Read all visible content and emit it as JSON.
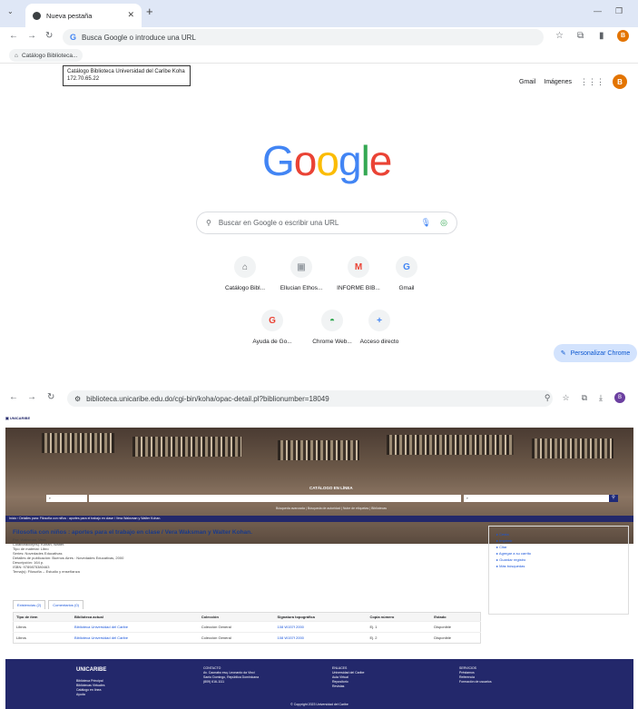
{
  "top_window": {
    "tab_title": "Nueva pestaña",
    "omnibox_placeholder": "Busca Google o introduce una URL",
    "bookmark": "Catálogo Biblioteca...",
    "tooltip_line1": "Catálogo Biblioteca Universidad del Caribe Koha",
    "tooltip_line2": "172.70.65.22",
    "links": {
      "gmail": "Gmail",
      "images": "Imágenes"
    },
    "avatar_letter": "B",
    "search_placeholder": "Buscar en Google o escribir una URL",
    "shortcuts": [
      {
        "label": "Catálogo Bibl...",
        "glyph": "⌂"
      },
      {
        "label": "Ellucian Ethos...",
        "glyph": "▣"
      },
      {
        "label": "INFORME BIB...",
        "glyph": "M"
      },
      {
        "label": "Gmail",
        "glyph": "G"
      },
      {
        "label": "Ayuda de Go...",
        "glyph": "G"
      },
      {
        "label": "Chrome Web...",
        "glyph": "◓"
      },
      {
        "label": "Acceso directo",
        "glyph": "+"
      }
    ],
    "customize_label": "Personalizar Chrome",
    "colors": {
      "blue": "#4285f4",
      "red": "#ea4335",
      "yellow": "#fbbc05",
      "green": "#34a853",
      "accent": "#d3e3fd"
    }
  },
  "bottom_window": {
    "url": "biblioteca.unicaribe.edu.do/cgi-bin/koha/opac-detail.pl?biblionumber=18049",
    "hero_title": "CATÁLOGO EN LÍNEA",
    "hero_links": "Búsqueda avanzada | Búsqueda de autoridad | Nube de etiquetas | Bibliotecas",
    "breadcrumb": "Inicio › Detalles para: Filosofía con niños : aportes para el trabajo en clase / Vera Waksman y Walter Kohan.",
    "record_title": "Filosofía con niños : aportes para el trabajo en clase / Vera Waksman y Walter Kohan.",
    "record_lines": [
      "Por: Waksman, Vera.",
      "Colaborador(es): Kohan, Walter.",
      "Tipo de material: Libro",
      "Series: Novedades Educativas",
      "Detalles de publicación: Buenos Aires : Novedades Educativas, 2000",
      "Descripción: 164 p.",
      "ISBN: 9789875380463",
      "Tema(s): Filosofía -- Estudio y enseñanza"
    ],
    "side_actions": [
      "Cesta",
      "Imprimir",
      "Citar",
      "Agregar a su carrito",
      "Guardar registro",
      "Más búsquedas"
    ],
    "holding_tabs": [
      "Existencias (2)",
      "Comentarios (0)"
    ],
    "table_headers": [
      "Tipo de ítem",
      "Biblioteca actual",
      "Colección",
      "Signatura topográfica",
      "Copia número",
      "Estado"
    ],
    "table_rows": [
      [
        "Libros",
        "Biblioteca Universidad del Caribe",
        "Colección General",
        "108 W157f 2000",
        "Ej. 1",
        "Disponible"
      ],
      [
        "Libros",
        "Biblioteca Universidad del Caribe",
        "Colección General",
        "108 W157f 2000",
        "Ej. 2",
        "Disponible"
      ]
    ],
    "footer_brand": "UNICARIBE",
    "footer_cols": [
      [
        "Biblioteca Principal",
        "Bibliotecas Virtuales",
        "Catálogo en línea",
        "Ayuda"
      ],
      [
        "CONTACTO",
        "Av. Caonabo esq. Leonardo da Vinci",
        "Santo Domingo, República Dominicana",
        "(809) 616-1111"
      ],
      [
        "ENLACES",
        "Universidad del Caribe",
        "Aula Virtual",
        "Repositorio",
        "Revistas"
      ],
      [
        "SERVICIOS",
        "Préstamos",
        "Referencia",
        "Formación de usuarios"
      ]
    ],
    "footer_copy": "© Copyright 2023 Universidad del Caribe"
  }
}
